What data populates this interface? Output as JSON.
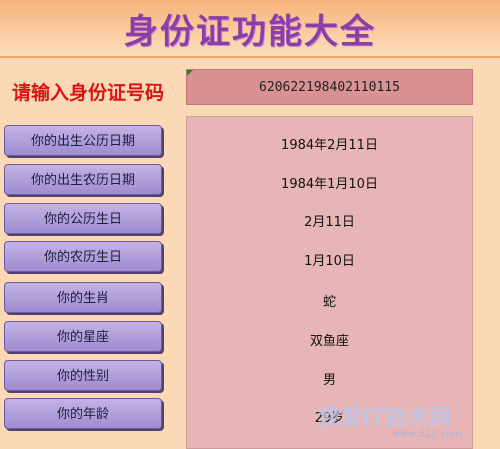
{
  "title": "身份证功能大全",
  "id_input": {
    "label": "请输入身份证号码",
    "value": "620622198402110115"
  },
  "rows": [
    {
      "button": "你的出生公历日期",
      "value": "1984年2月11日"
    },
    {
      "button": "你的出生农历日期",
      "value": "1984年1月10日"
    },
    {
      "button": "你的公历生日",
      "value": "2月11日"
    },
    {
      "button": "你的农历生日",
      "value": "1月10日"
    },
    {
      "button": "你的生肖",
      "value": "蛇"
    },
    {
      "button": "你的星座",
      "value": "双鱼座"
    },
    {
      "button": "你的性别",
      "value": "男"
    },
    {
      "button": "你的年龄",
      "value": "29岁"
    }
  ],
  "watermark": {
    "text": "我爱IT技术网",
    "url": "www.52ij.com"
  }
}
